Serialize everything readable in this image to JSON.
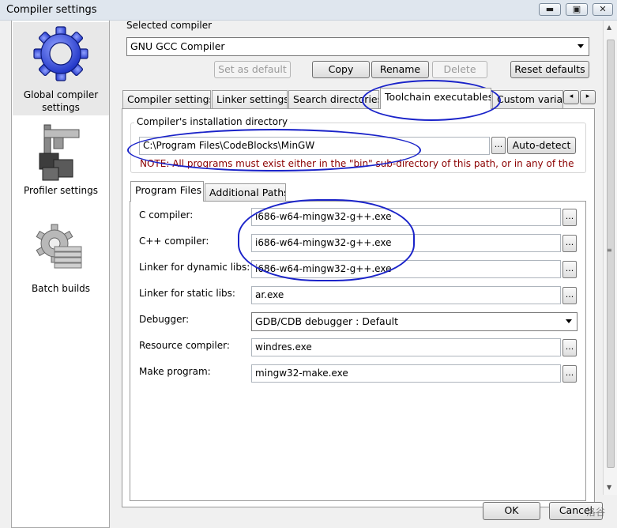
{
  "window": {
    "title": "Compiler settings",
    "minimize": "▬",
    "maximize": "▣",
    "close": "✕"
  },
  "sidebar": {
    "items": [
      {
        "label": "Global compiler settings",
        "icon": "gear-icon"
      },
      {
        "label": "Profiler settings",
        "icon": "profiler-caliper-icon"
      },
      {
        "label": "Batch builds",
        "icon": "batch-gear-icon"
      }
    ]
  },
  "compiler": {
    "group_label": "Selected compiler",
    "selected": "GNU GCC Compiler",
    "buttons": {
      "set_default": "Set as default",
      "copy": "Copy",
      "rename": "Rename",
      "delete": "Delete",
      "reset": "Reset defaults"
    }
  },
  "tabs": [
    "Compiler settings",
    "Linker settings",
    "Search directories",
    "Toolchain executables",
    "Custom variabl"
  ],
  "install_dir": {
    "label": "Compiler's installation directory",
    "value": "C:\\Program Files\\CodeBlocks\\MinGW",
    "dots": "...",
    "autodetect": "Auto-detect",
    "note": "NOTE: All programs must exist either in the \"bin\" sub-directory of this path, or in any of the"
  },
  "subtabs": [
    "Program Files",
    "Additional Paths"
  ],
  "programs": {
    "c_compiler": {
      "label": "C compiler:",
      "value": "i686-w64-mingw32-g++.exe"
    },
    "cpp_compiler": {
      "label": "C++ compiler:",
      "value": "i686-w64-mingw32-g++.exe"
    },
    "linker_dynamic": {
      "label": "Linker for dynamic libs:",
      "value": "i686-w64-mingw32-g++.exe"
    },
    "linker_static": {
      "label": "Linker for static libs:",
      "value": "ar.exe"
    },
    "debugger": {
      "label": "Debugger:",
      "value": "GDB/CDB debugger : Default"
    },
    "resource_compiler": {
      "label": "Resource compiler:",
      "value": "windres.exe"
    },
    "make_program": {
      "label": "Make program:",
      "value": "mingw32-make.exe"
    }
  },
  "dialog_buttons": {
    "ok": "OK",
    "cancel": "Cancel",
    "overlay_text": "洛谷"
  }
}
